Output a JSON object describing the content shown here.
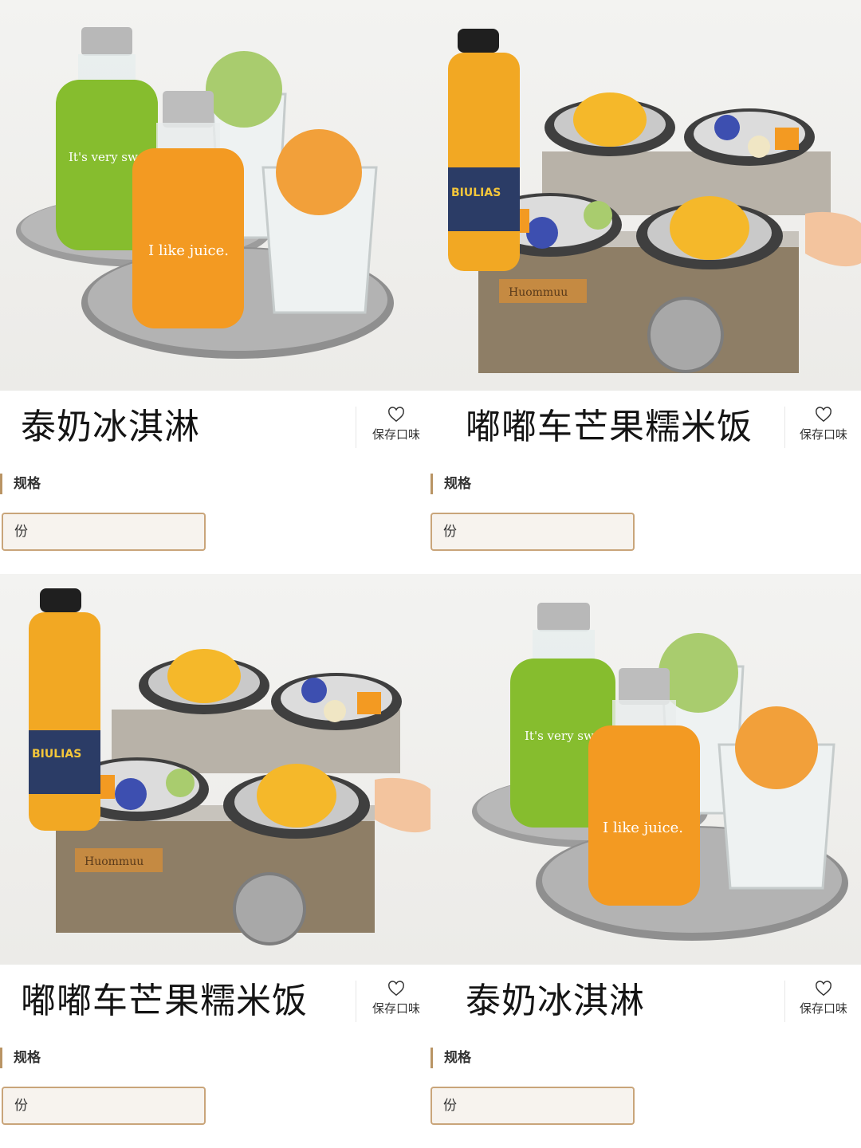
{
  "products": [
    {
      "title": "泰奶冰淇淋",
      "save_label": "保存口味",
      "spec_label": "规格",
      "option": "份",
      "image": "juice-bottles-ice-cream",
      "bottle_texts": [
        "It's very sweet",
        "I like juice."
      ]
    },
    {
      "title": "嘟嘟车芒果糯米饭",
      "save_label": "保存口味",
      "spec_label": "规格",
      "option": "份",
      "image": "tuktuk-mango-sticky-rice",
      "bottle_texts": [
        "BIULIAS",
        "Huommuu"
      ]
    },
    {
      "title": "嘟嘟车芒果糯米饭",
      "save_label": "保存口味",
      "spec_label": "规格",
      "option": "份",
      "image": "tuktuk-mango-sticky-rice",
      "bottle_texts": [
        "BIULIAS",
        "Huommuu"
      ]
    },
    {
      "title": "泰奶冰淇淋",
      "save_label": "保存口味",
      "spec_label": "规格",
      "option": "份",
      "image": "juice-bottles-ice-cream",
      "bottle_texts": [
        "It's very sweet",
        "I like juice."
      ]
    }
  ],
  "colors": {
    "accent": "#b99464",
    "option_border": "#c9a57a",
    "option_bg": "#f7f3ee",
    "title": "#141414"
  },
  "icons": {
    "save": "heart-outline-icon"
  }
}
